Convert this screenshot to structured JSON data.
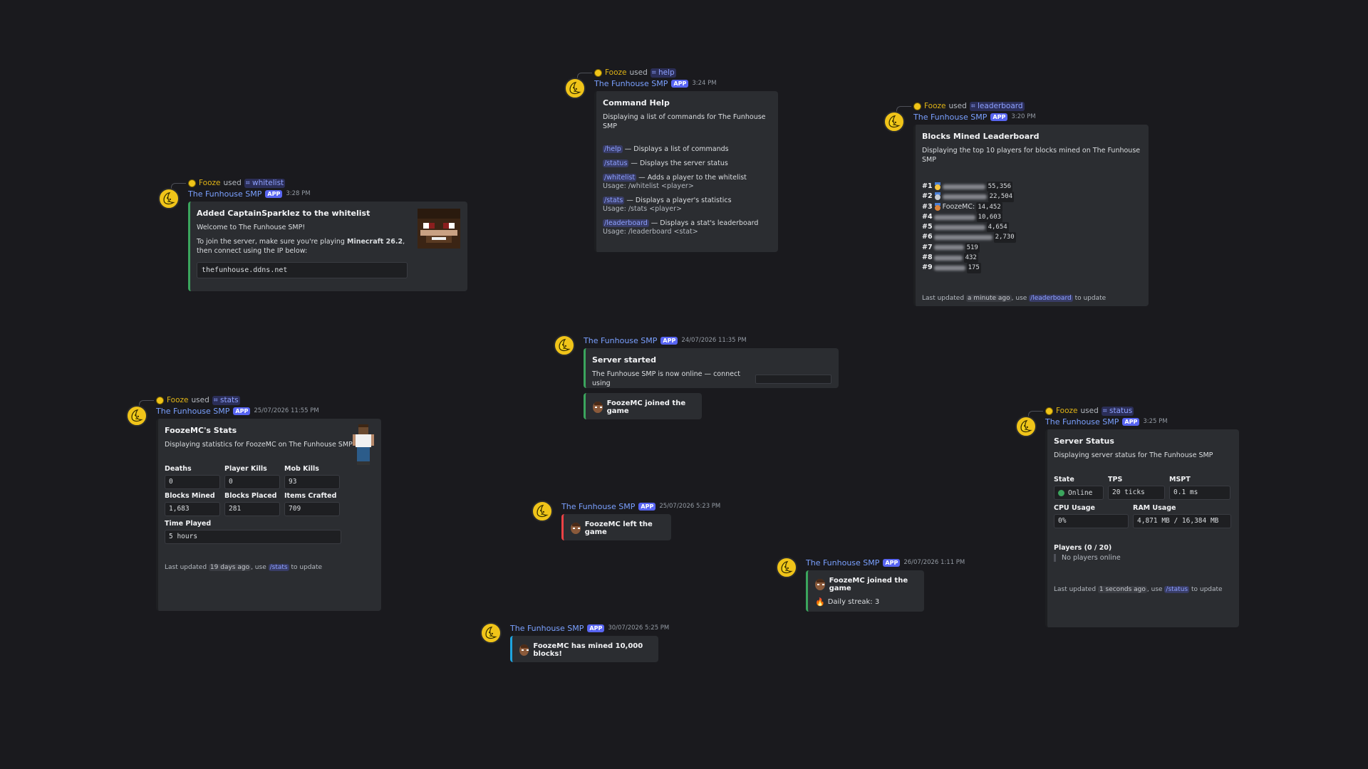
{
  "user": "Fooze",
  "used_text": "used",
  "bot": "The Funhouse SMP",
  "app_tag": "APP",
  "whitelist_msg": {
    "command": "whitelist",
    "time": "3:28 PM",
    "title": "Added CaptainSparklez to the whitelist",
    "welcome": "Welcome to The Funhouse SMP!",
    "join_pre": "To join the server, make sure you're playing",
    "join_version": "Minecraft 26.2",
    "join_post": ", then connect using the IP below:",
    "ip": "thefunhouse.ddns.net",
    "thumbnail_icon": "captainsparklez-skin-face-icon"
  },
  "help_msg": {
    "command": "help",
    "time": "3:24 PM",
    "title": "Command Help",
    "desc": "Displaying a list of commands for The Funhouse SMP",
    "commands": [
      {
        "cmd": "/help",
        "text": " — Displays a list of commands",
        "usage": ""
      },
      {
        "cmd": "/status",
        "text": " — Displays the server status",
        "usage": ""
      },
      {
        "cmd": "/whitelist",
        "text": " — Adds a player to the whitelist",
        "usage": "Usage: /whitelist <player>"
      },
      {
        "cmd": "/stats",
        "text": " — Displays a player's statistics",
        "usage": "Usage: /stats <player>"
      },
      {
        "cmd": "/leaderboard",
        "text": " — Displays a stat's leaderboard",
        "usage": "Usage: /leaderboard <stat>"
      }
    ]
  },
  "leaderboard_msg": {
    "command": "leaderboard",
    "time": "3:20 PM",
    "title": "Blocks Mined Leaderboard",
    "desc": "Displaying the top 10 players for blocks mined on The Funhouse SMP",
    "rows": [
      {
        "rank": "#1",
        "medal": "gold",
        "name": "",
        "value": "55,356"
      },
      {
        "rank": "#2",
        "medal": "silver",
        "name": "",
        "value": "22,504"
      },
      {
        "rank": "#3",
        "medal": "bronze",
        "name": "FoozeMC:",
        "value": "14,452"
      },
      {
        "rank": "#4",
        "medal": "",
        "name": "",
        "value": "10,603"
      },
      {
        "rank": "#5",
        "medal": "",
        "name": "",
        "value": "4,654"
      },
      {
        "rank": "#6",
        "medal": "",
        "name": "",
        "value": "2,730"
      },
      {
        "rank": "#7",
        "medal": "",
        "name": "",
        "value": "519"
      },
      {
        "rank": "#8",
        "medal": "",
        "name": "",
        "value": "432"
      },
      {
        "rank": "#9",
        "medal": "",
        "name": "",
        "value": "175"
      }
    ],
    "footer_pre": "Last updated",
    "footer_ago": "a minute ago",
    "footer_mid": ", use",
    "footer_cmd": "/leaderboard",
    "footer_post": "to update"
  },
  "server_started_msg": {
    "time": "24/07/2026 11:35 PM",
    "title": "Server started",
    "desc": "The Funhouse SMP is now online — connect using",
    "joined": "FoozeMC joined the game"
  },
  "stats_msg": {
    "command": "stats",
    "time": "25/07/2026 11:55 PM",
    "title": "FoozeMC's Stats",
    "desc": "Displaying statistics for FoozeMC on The Funhouse SMP",
    "fields": [
      {
        "label": "Deaths",
        "value": "0"
      },
      {
        "label": "Player Kills",
        "value": "0"
      },
      {
        "label": "Mob Kills",
        "value": "93"
      },
      {
        "label": "Blocks Mined",
        "value": "1,683"
      },
      {
        "label": "Blocks Placed",
        "value": "281"
      },
      {
        "label": "Items Crafted",
        "value": "709"
      }
    ],
    "time_played_label": "Time Played",
    "time_played": "5 hours",
    "footer_pre": "Last updated",
    "footer_ago": "19 days ago",
    "footer_mid": ", use",
    "footer_cmd": "/stats",
    "footer_post": "to update"
  },
  "left_msg": {
    "time": "25/07/2026 5:23 PM",
    "text": "FoozeMC left the game"
  },
  "streak_msg": {
    "time": "26/07/2026 1:11 PM",
    "text": "FoozeMC joined the game",
    "streak": "Daily streak: 3"
  },
  "mined_msg": {
    "time": "30/07/2026 5:25 PM",
    "text": "FoozeMC has mined 10,000 blocks!"
  },
  "status_msg": {
    "command": "status",
    "time": "3:25 PM",
    "title": "Server Status",
    "desc": "Displaying server status for The Funhouse SMP",
    "state_label": "State",
    "state": "Online",
    "tps_label": "TPS",
    "tps": "20 ticks",
    "mspt_label": "MSPT",
    "mspt": "0.1 ms",
    "cpu_label": "CPU Usage",
    "cpu": "0%",
    "ram_label": "RAM Usage",
    "ram": "4,871 MB / 16,384 MB",
    "players_label": "Players (0 / 20)",
    "players": "No players online",
    "footer_pre": "Last updated",
    "footer_ago": "1 seconds ago",
    "footer_mid": ", use",
    "footer_cmd": "/status",
    "footer_post": "to update"
  }
}
